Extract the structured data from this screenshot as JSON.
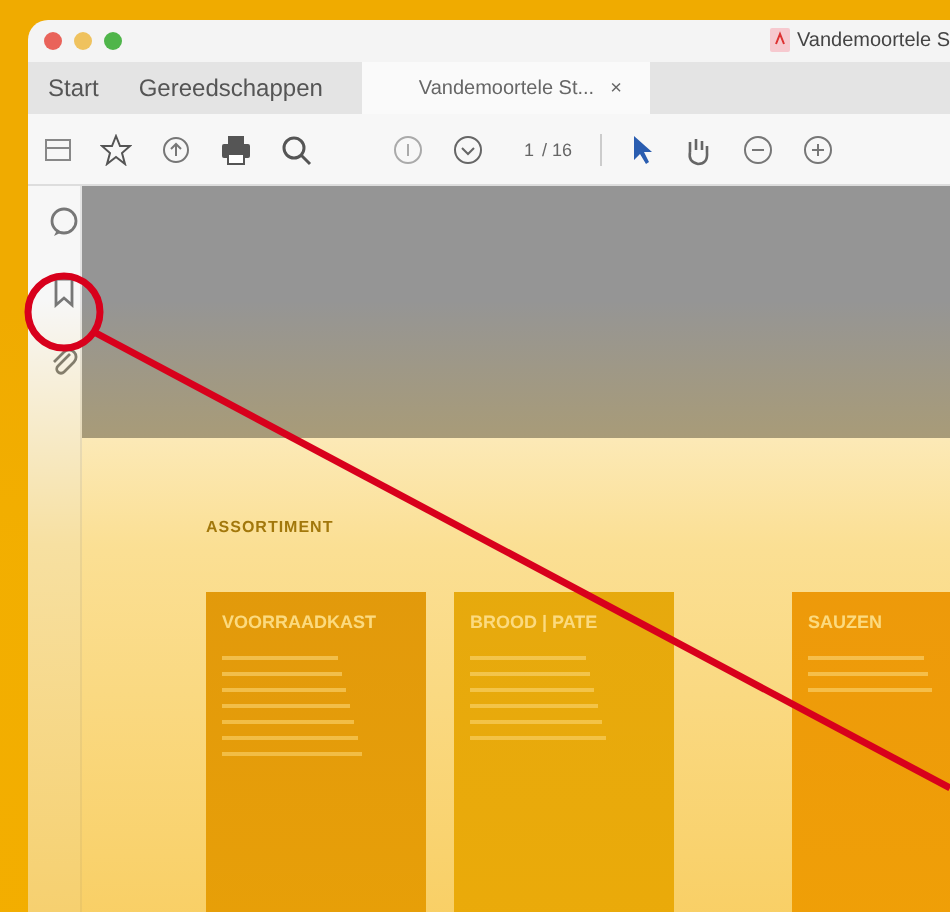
{
  "window": {
    "title": "Vandemoortele S"
  },
  "tabs": [
    {
      "label": "Start",
      "selected": false
    },
    {
      "label": "Gereedschappen",
      "selected": false
    },
    {
      "label": "Vandemoortele St...",
      "selected": true,
      "close": "×"
    }
  ],
  "toolbar": {
    "page_current": "1",
    "page_total": "/ 16"
  },
  "sidebar": {
    "items": [
      {
        "kind": "comment",
        "selected": false
      },
      {
        "kind": "bookmark",
        "selected": false
      },
      {
        "kind": "attachment",
        "selected": false
      }
    ]
  },
  "document": {
    "heading": "ASSORTIMENT",
    "cards": [
      {
        "title": "VOORRAADKAST"
      },
      {
        "title": "BROOD | PATE"
      },
      {
        "title": "SAUZEN"
      }
    ]
  },
  "annotation": {
    "kind": "circle-arrow"
  }
}
